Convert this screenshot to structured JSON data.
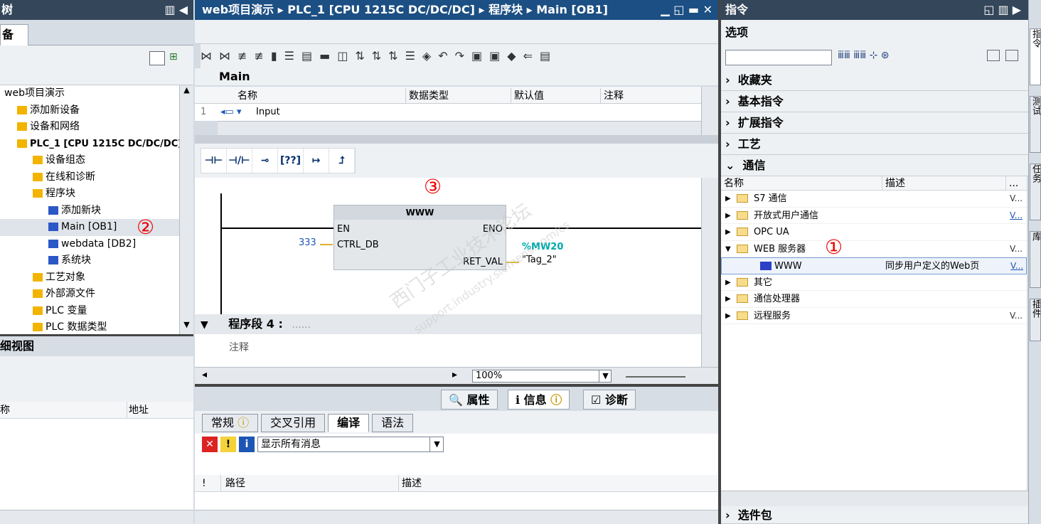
{
  "left_panel": {
    "header_title": "树",
    "tab_label": "备",
    "tree": [
      {
        "label": "web项目演示",
        "indent": 0
      },
      {
        "label": "添加新设备",
        "indent": 1
      },
      {
        "label": "设备和网络",
        "indent": 1
      },
      {
        "label": "PLC_1 [CPU 1215C DC/DC/DC]",
        "indent": 1
      },
      {
        "label": "设备组态",
        "indent": 2
      },
      {
        "label": "在线和诊断",
        "indent": 2
      },
      {
        "label": "程序块",
        "indent": 2
      },
      {
        "label": "添加新块",
        "indent": 3
      },
      {
        "label": "Main [OB1]",
        "indent": 3
      },
      {
        "label": "webdata [DB2]",
        "indent": 3
      },
      {
        "label": "系统块",
        "indent": 3
      },
      {
        "label": "工艺对象",
        "indent": 2
      },
      {
        "label": "外部源文件",
        "indent": 2
      },
      {
        "label": "PLC 变量",
        "indent": 2
      },
      {
        "label": "PLC 数据类型",
        "indent": 2
      }
    ],
    "detail_view_title": "细视图",
    "detail_cols": [
      "称",
      "地址"
    ],
    "marker": "②"
  },
  "editor": {
    "breadcrumb": [
      "web项目演示",
      "PLC_1 [CPU 1215C DC/DC/DC]",
      "程序块",
      "Main [OB1]"
    ],
    "block_name": "Main",
    "iface_cols": [
      "名称",
      "数据类型",
      "默认值",
      "注释"
    ],
    "iface_row": {
      "num": "1",
      "name": "Input"
    },
    "ladder_buttons": [
      "⊣⊢",
      "⊣/⊢",
      "⊸",
      "[??]",
      "↦",
      "⮥"
    ],
    "block": {
      "title": "WWW",
      "en": "EN",
      "eno": "ENO",
      "ctrl_db": "CTRL_DB",
      "ret_val": "RET_VAL",
      "ctrl_val": "333",
      "tag_addr": "%MW20",
      "tag_name": "\"Tag_2\""
    },
    "network_title": "程序段 4 :",
    "network_dots": "......",
    "comment": "注释",
    "zoom": "100%",
    "marker": "③"
  },
  "inspector": {
    "tabs": [
      "属性",
      "信息",
      "诊断"
    ],
    "subtabs": [
      "常规",
      "交叉引用",
      "编译",
      "语法"
    ],
    "filter": "显示所有消息",
    "cols": [
      "!",
      "路径",
      "描述"
    ]
  },
  "instructions": {
    "header_title": "指令",
    "options_label": "选项",
    "categories": [
      "收藏夹",
      "基本指令",
      "扩展指令",
      "工艺",
      "通信"
    ],
    "cols": [
      "名称",
      "描述",
      "..."
    ],
    "items": [
      {
        "name": "S7 通信",
        "desc": "",
        "ver": "V..."
      },
      {
        "name": "开放式用户通信",
        "desc": "",
        "ver": "V..."
      },
      {
        "name": "OPC UA",
        "desc": "",
        "ver": ""
      },
      {
        "name": "WEB 服务器",
        "desc": "",
        "ver": "V..."
      },
      {
        "name": "WWW",
        "desc": "同步用户定义的Web页",
        "ver": "V..."
      },
      {
        "name": "其它",
        "desc": "",
        "ver": ""
      },
      {
        "name": "通信处理器",
        "desc": "",
        "ver": ""
      },
      {
        "name": "远程服务",
        "desc": "",
        "ver": "V..."
      }
    ],
    "bottom_category": "选件包",
    "marker": "①"
  },
  "watermark": {
    "line1": "西门子工业技术论坛",
    "line2": "support.industry.siemens.com/cs"
  },
  "side_tabs": [
    "指令",
    "测试",
    "任务",
    "库",
    "插件"
  ]
}
